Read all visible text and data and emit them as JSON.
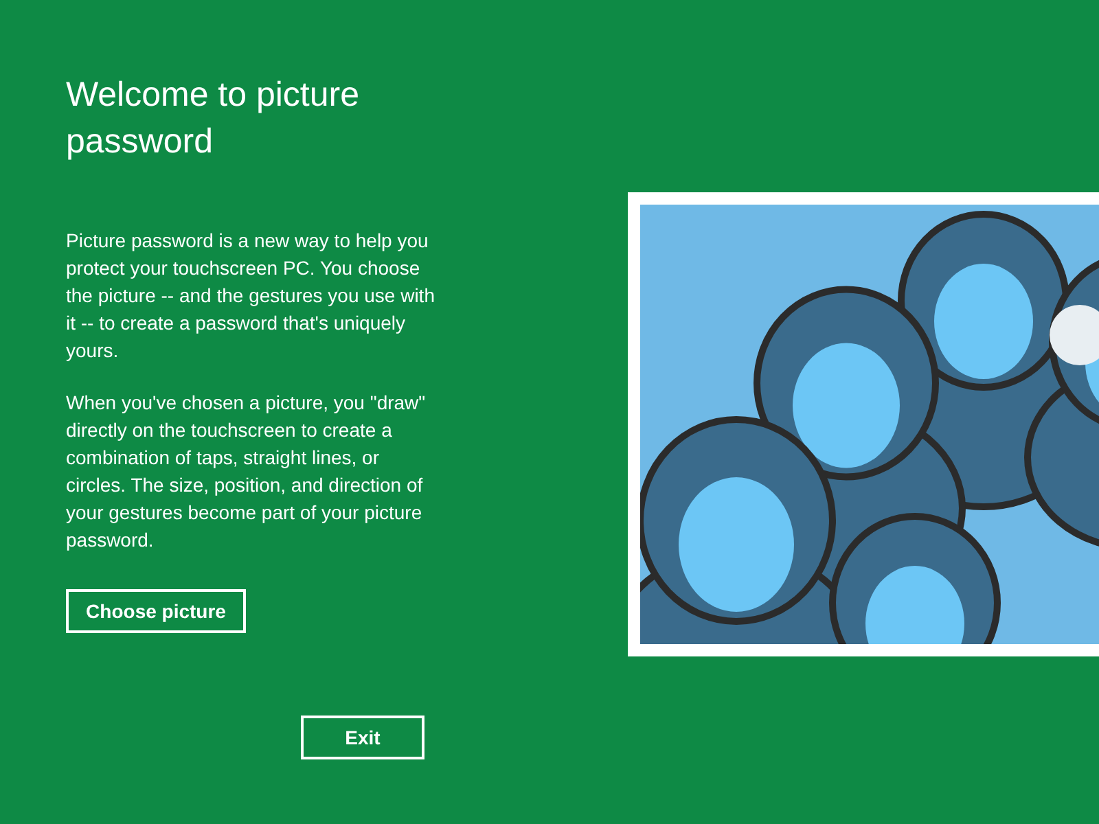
{
  "title": "Welcome to picture password",
  "paragraphs": [
    "Picture password is a new way to help you protect your touchscreen PC. You choose the picture -- and the gestures you use with it -- to create a password that's uniquely yours.",
    "When you've chosen a picture, you \"draw\" directly on the touchscreen to create a combination of taps, straight lines, or circles. The size, position, and direction of your gestures become part of your picture password."
  ],
  "choose_button": "Choose picture",
  "exit_button": "Exit"
}
